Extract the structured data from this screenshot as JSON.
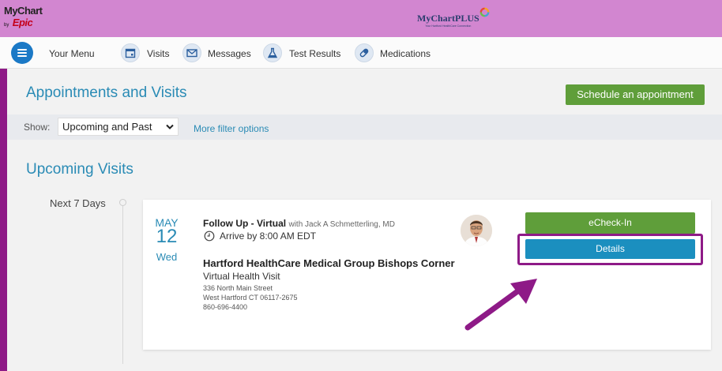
{
  "header": {
    "logo_line1": "MyChart",
    "logo_by": "by",
    "logo_brand": "Epic",
    "plus_logo": "MyChartPLUS",
    "plus_tagline": "Your Hartford HealthCare Connection"
  },
  "nav": {
    "menu_label": "Your Menu",
    "items": [
      {
        "label": "Visits",
        "icon": "calendar-icon"
      },
      {
        "label": "Messages",
        "icon": "envelope-icon"
      },
      {
        "label": "Test Results",
        "icon": "flask-icon"
      },
      {
        "label": "Medications",
        "icon": "pill-icon"
      }
    ]
  },
  "page": {
    "title": "Appointments and Visits",
    "schedule_button": "Schedule an appointment"
  },
  "filter": {
    "show_label": "Show:",
    "selected": "Upcoming and Past",
    "more": "More filter options"
  },
  "upcoming": {
    "heading": "Upcoming Visits",
    "group": "Next 7 Days"
  },
  "visit": {
    "month": "MAY",
    "day": "12",
    "weekday": "Wed",
    "type": "Follow Up - Virtual",
    "with": "with Jack A Schmetterling, MD",
    "arrive": "Arrive by 8:00 AM EDT",
    "department": "Hartford HealthCare Medical Group Bishops Corner",
    "location": "Virtual Health Visit",
    "street": "336 North Main Street",
    "city": "West Hartford CT 06117-2675",
    "phone": "860-696-4400",
    "echeck_button": "eCheck-In",
    "details_button": "Details"
  },
  "colors": {
    "header_bg": "#d286d0",
    "accent_blue": "#2a8bb5",
    "green_button": "#5f9e3a",
    "details_blue": "#1b8fbf",
    "highlight_purple": "#8e1a87"
  }
}
